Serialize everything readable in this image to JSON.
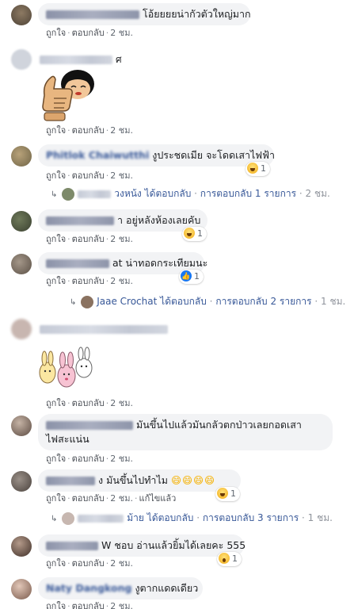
{
  "actions": {
    "like": "ถูกใจ",
    "reply": "ตอบกลับ",
    "sep": "·"
  },
  "comments": [
    {
      "text": "โอ้ยยยยน่ากัวตัวใหญ่มาก",
      "time": "2 ชม."
    },
    {
      "name_tail": "ศ",
      "time": "2 ชม.",
      "sticker": "thumbs-up-girl"
    },
    {
      "name": "Phitlok Chaiwutthi",
      "text": "งูประชดเมีย จะโดดเสาไฟฟ้า",
      "time": "2 ชม.",
      "reaction_count": "1",
      "reply": {
        "name_tail": "วงหน้ง",
        "action": "ได้ตอบกลับ",
        "count_text": "การตอบกลับ 1 รายการ",
        "time": "2 ชม."
      }
    },
    {
      "text": "อยู่หลังห้องเลยคับ",
      "name_tail": "า",
      "time": "2 ชม.",
      "reaction_count": "1"
    },
    {
      "text": "น่าทอดกระเทียมนะ",
      "name_tail": "at",
      "time": "2 ชม.",
      "reaction_count": "1",
      "reply": {
        "name": "Jaae Crochat",
        "action": "ได้ตอบกลับ",
        "count_text": "การตอบกลับ 2 รายการ",
        "time": "1 ชม."
      }
    },
    {
      "time": "2 ชม.",
      "sticker": "bunnies"
    },
    {
      "name_tail": "มัน",
      "text": "ขึ้นไปแล้วมันกลัวตกป่าวเลยกอดเสา",
      "text2": "ไฟสะแน่น",
      "time": "2 ชม."
    },
    {
      "name_tail": "ง",
      "text": "มันขึ้นไปทำไม",
      "emojis": "😄😄😄😄",
      "time": "2 ชม.",
      "edited": "แก้ไขแล้ว",
      "reaction_count": "1",
      "reply": {
        "name_tail": "ม้าย",
        "action": "ได้ตอบกลับ",
        "count_text": "การตอบกลับ 3 รายการ",
        "time": "1 ชม."
      }
    },
    {
      "name_tail": "W",
      "text": "ชอบ อ่านแล้วยิ้มได้เลยคะ 555",
      "time": "2 ชม.",
      "reaction_count": "1"
    },
    {
      "name": "Naty Dangkong",
      "text": "งูตากแดดเดียว",
      "time": "2 ชม."
    }
  ]
}
